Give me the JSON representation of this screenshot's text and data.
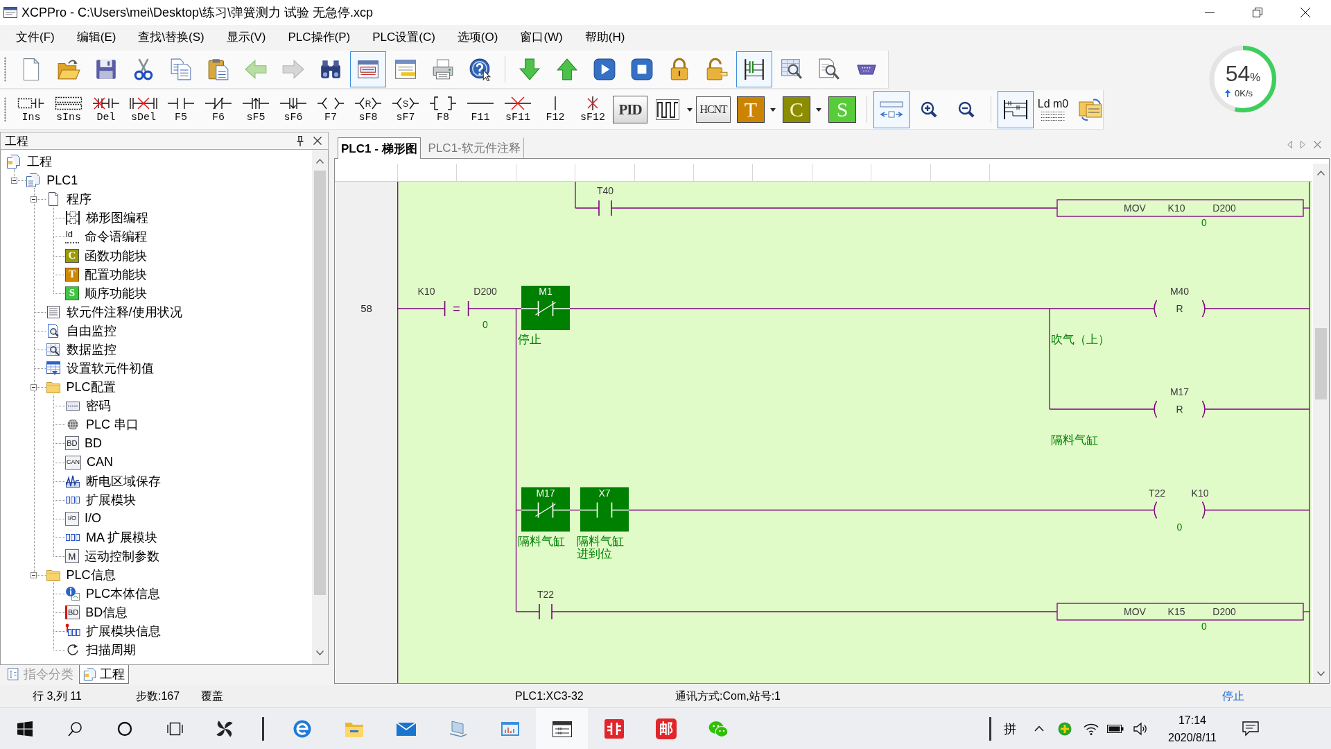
{
  "window": {
    "title": "XCPPro - C:\\Users\\mei\\Desktop\\练习\\弹簧测力 试验 无急停.xcp"
  },
  "menu": [
    "文件(F)",
    "编辑(E)",
    "查找\\替换(S)",
    "显示(V)",
    "PLC操作(P)",
    "PLC设置(C)",
    "选项(O)",
    "窗口(W)",
    "帮助(H)"
  ],
  "toolbar_1": [
    [
      {
        "kind": "new",
        "selected": false
      },
      {
        "kind": "open",
        "selected": false
      },
      {
        "kind": "save",
        "selected": false
      },
      {
        "kind": "cut",
        "selected": false
      },
      {
        "kind": "copy",
        "selected": false
      },
      {
        "kind": "paste",
        "selected": false
      },
      {
        "kind": "back",
        "selected": false
      },
      {
        "kind": "forward",
        "selected": false
      },
      {
        "kind": "find",
        "selected": false
      },
      {
        "kind": "monitor-window",
        "selected": true
      },
      {
        "kind": "list-window",
        "selected": false
      },
      {
        "kind": "print",
        "selected": false
      },
      {
        "kind": "help",
        "selected": false
      }
    ],
    [
      {
        "kind": "download",
        "selected": false
      },
      {
        "kind": "upload",
        "selected": false
      },
      {
        "kind": "run",
        "selected": false
      },
      {
        "kind": "stop",
        "selected": false
      },
      {
        "kind": "lock",
        "selected": false
      },
      {
        "kind": "unlock",
        "selected": false
      },
      {
        "kind": "ladder-monitor",
        "selected": true
      },
      {
        "kind": "table-search",
        "selected": false
      },
      {
        "kind": "doc-search",
        "selected": false
      },
      {
        "kind": "port",
        "selected": false
      }
    ]
  ],
  "toolbar_2": [
    [
      {
        "kind": "insert",
        "label": "Ins",
        "selected": false
      },
      {
        "kind": "insert-line",
        "label": "sIns",
        "selected": false
      },
      {
        "kind": "delete",
        "label": "Del",
        "selected": false
      },
      {
        "kind": "delete-line",
        "label": "sDel",
        "selected": false
      },
      {
        "kind": "contact",
        "label": "F5",
        "selected": false
      },
      {
        "kind": "closed-contact",
        "label": "F6",
        "selected": false
      },
      {
        "kind": "rising-contact",
        "label": "sF5",
        "selected": false
      },
      {
        "kind": "falling-contact",
        "label": "sF6",
        "selected": false
      },
      {
        "kind": "coil",
        "label": "F7",
        "selected": false
      },
      {
        "kind": "reset-coil",
        "label": "sF8",
        "icon_text": "R",
        "selected": false
      },
      {
        "kind": "set-coil",
        "label": "sF7",
        "icon_text": "S",
        "selected": false
      },
      {
        "kind": "instruction",
        "label": "F8",
        "selected": false
      },
      {
        "kind": "hline",
        "label": "F11",
        "selected": false
      },
      {
        "kind": "hline-delete",
        "label": "sF11",
        "selected": false
      },
      {
        "kind": "vline",
        "label": "F12",
        "selected": false
      },
      {
        "kind": "vline-delete",
        "label": "sF12",
        "selected": false
      },
      {
        "kind": "pid",
        "label": "PID",
        "selected": false
      },
      {
        "kind": "pulse",
        "dropdown": true,
        "selected": false
      },
      {
        "kind": "hcnt",
        "label": "HCNT",
        "selected": false
      },
      {
        "kind": "timer",
        "label": "T",
        "dropdown": true,
        "selected": false
      },
      {
        "kind": "counter",
        "label": "C",
        "dropdown": true,
        "selected": false
      },
      {
        "kind": "sequence",
        "label": "S",
        "selected": false
      }
    ],
    [
      {
        "kind": "fit",
        "selected": true
      },
      {
        "kind": "zoom-in",
        "selected": false
      },
      {
        "kind": "zoom-out",
        "selected": false
      }
    ],
    [
      {
        "kind": "ladder-view",
        "selected": true
      },
      {
        "kind": "list-view",
        "label": "Ld m0",
        "selected": false
      },
      {
        "kind": "convert",
        "selected": false
      }
    ]
  ],
  "memory_meter": {
    "value": "54",
    "unit": "%",
    "speed": "0K/s",
    "level": 0.54
  },
  "project_panel": {
    "title": "工程",
    "tree": [
      {
        "label": "工程",
        "kind": "project",
        "children": [
          {
            "label": "PLC1",
            "kind": "plc",
            "expanded": true,
            "children": [
              {
                "label": "程序",
                "kind": "page",
                "expanded": true,
                "children": [
                  {
                    "label": "梯形图编程",
                    "kind": "ladder"
                  },
                  {
                    "label": "命令语编程",
                    "kind": "instruction-list",
                    "icon_text": "ld"
                  },
                  {
                    "label": "函数功能块",
                    "kind": "function-block",
                    "icon_text": "C"
                  },
                  {
                    "label": "配置功能块",
                    "kind": "config-block",
                    "icon_text": "T"
                  },
                  {
                    "label": "顺序功能块",
                    "kind": "sequence-block",
                    "icon_text": "S"
                  }
                ]
              },
              {
                "label": "软元件注释/使用状况",
                "kind": "list"
              },
              {
                "label": "自由监控",
                "kind": "free-monitor"
              },
              {
                "label": "数据监控",
                "kind": "data-monitor"
              },
              {
                "label": "设置软元件初值",
                "kind": "init-values"
              },
              {
                "label": "PLC配置",
                "kind": "folder",
                "expanded": true,
                "children": [
                  {
                    "label": "密码",
                    "kind": "password"
                  },
                  {
                    "label": "PLC 串口",
                    "kind": "serial"
                  },
                  {
                    "label": "BD",
                    "kind": "label-tile",
                    "icon_text": "BD"
                  },
                  {
                    "label": "CAN",
                    "kind": "label-tile",
                    "icon_text": "CAN"
                  },
                  {
                    "label": "断电区域保存",
                    "kind": "wave"
                  },
                  {
                    "label": "扩展模块",
                    "kind": "module"
                  },
                  {
                    "label": "I/O",
                    "kind": "label-tile",
                    "icon_text": "I/O"
                  },
                  {
                    "label": "MA 扩展模块",
                    "kind": "module"
                  },
                  {
                    "label": "运动控制参数",
                    "kind": "label-tile",
                    "icon_text": "M"
                  }
                ]
              },
              {
                "label": "PLC信息",
                "kind": "folder",
                "expanded": true,
                "children": [
                  {
                    "label": "PLC本体信息",
                    "kind": "info"
                  },
                  {
                    "label": "BD信息",
                    "kind": "flag-tile",
                    "icon_text": "BD"
                  },
                  {
                    "label": "扩展模块信息",
                    "kind": "flag-module"
                  },
                  {
                    "label": "扫描周期",
                    "kind": "cycle"
                  }
                ]
              }
            ]
          }
        ]
      }
    ],
    "tabs": [
      {
        "label": "指令分类",
        "kind": "instructions",
        "selected": false
      },
      {
        "label": "工程",
        "kind": "project",
        "selected": true
      }
    ]
  },
  "editor": {
    "tabs": [
      {
        "label": "PLC1 - 梯形图",
        "selected": true
      },
      {
        "label": "PLC1-软元件注释",
        "selected": false
      }
    ],
    "ladder": {
      "rung_number": "58",
      "elements": [
        {
          "kind": "contact",
          "normally_closed": false,
          "device": "T40",
          "active": false
        },
        {
          "kind": "mov",
          "op": "MOV",
          "source": "K10",
          "target": "D200",
          "value": "0"
        },
        {
          "kind": "compare",
          "left": "K10",
          "op": "=",
          "right": "D200",
          "value": "0"
        },
        {
          "kind": "contact",
          "normally_closed": true,
          "device": "M1",
          "active": true,
          "comment": "停止"
        },
        {
          "kind": "coil",
          "device": "M40",
          "op": "R",
          "comment": "吹气（上）"
        },
        {
          "kind": "coil",
          "device": "M17",
          "op": "R",
          "comment": "隔料气缸"
        },
        {
          "kind": "contact",
          "normally_closed": true,
          "device": "M17",
          "active": true,
          "comment": "隔料气缸"
        },
        {
          "kind": "contact",
          "normally_closed": false,
          "device": "X7",
          "active": true,
          "comment": "隔料气缸进到位"
        },
        {
          "kind": "timer",
          "device": "T22",
          "preset": "K10",
          "value": "0"
        },
        {
          "kind": "contact",
          "normally_closed": false,
          "device": "T22",
          "active": false
        },
        {
          "kind": "mov",
          "op": "MOV",
          "source": "K15",
          "target": "D200",
          "value": "0"
        }
      ]
    }
  },
  "status_bar": {
    "position": "行 3,列 11",
    "steps": "步数:167",
    "mode": "覆盖",
    "plc": "PLC1:XC3-32",
    "comm": "通讯方式:Com,站号:1",
    "run_state": "停止"
  },
  "taskbar": {
    "buttons": [
      {
        "kind": "start"
      },
      {
        "kind": "search"
      },
      {
        "kind": "assistant"
      },
      {
        "kind": "task-view"
      }
    ],
    "apps": [
      [
        {
          "kind": "pinwheel",
          "active": false
        }
      ],
      [
        {
          "kind": "edge",
          "active": false
        },
        {
          "kind": "explorer",
          "active": false
        },
        {
          "kind": "mail",
          "active": false
        },
        {
          "kind": "laptop",
          "active": false
        },
        {
          "kind": "chart",
          "active": false
        },
        {
          "kind": "xcp",
          "active": true
        },
        {
          "kind": "red-bars",
          "active": false
        },
        {
          "kind": "letter-tile",
          "icon_text": "邮",
          "active": false
        },
        {
          "kind": "wechat",
          "active": false
        }
      ]
    ],
    "ime": "拼",
    "time": "17:14",
    "date": "2020/8/11"
  }
}
